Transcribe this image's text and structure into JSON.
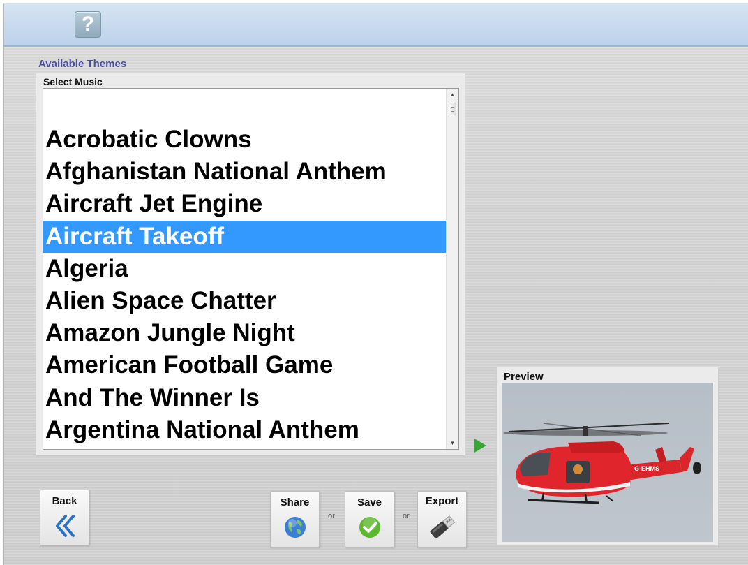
{
  "help": {
    "glyph": "?"
  },
  "themes_heading": "Available Themes",
  "music": {
    "label": "Select Music",
    "items": [
      "Acrobatic Clowns",
      "Afghanistan National Anthem",
      "Aircraft Jet Engine",
      "Aircraft Takeoff",
      "Algeria",
      "Alien Space Chatter",
      "Amazon Jungle Night",
      "American Football Game",
      "And The Winner Is",
      "Argentina National Anthem"
    ],
    "selected": "Aircraft Takeoff"
  },
  "preview": {
    "label": "Preview",
    "registration": "G-EHMS"
  },
  "buttons": {
    "back": "Back",
    "share": "Share",
    "save": "Save",
    "export": "Export",
    "or": "or"
  },
  "colors": {
    "selection": "#3399ff",
    "heading": "#4b4fa0",
    "play_arrow": "#3aa636"
  }
}
